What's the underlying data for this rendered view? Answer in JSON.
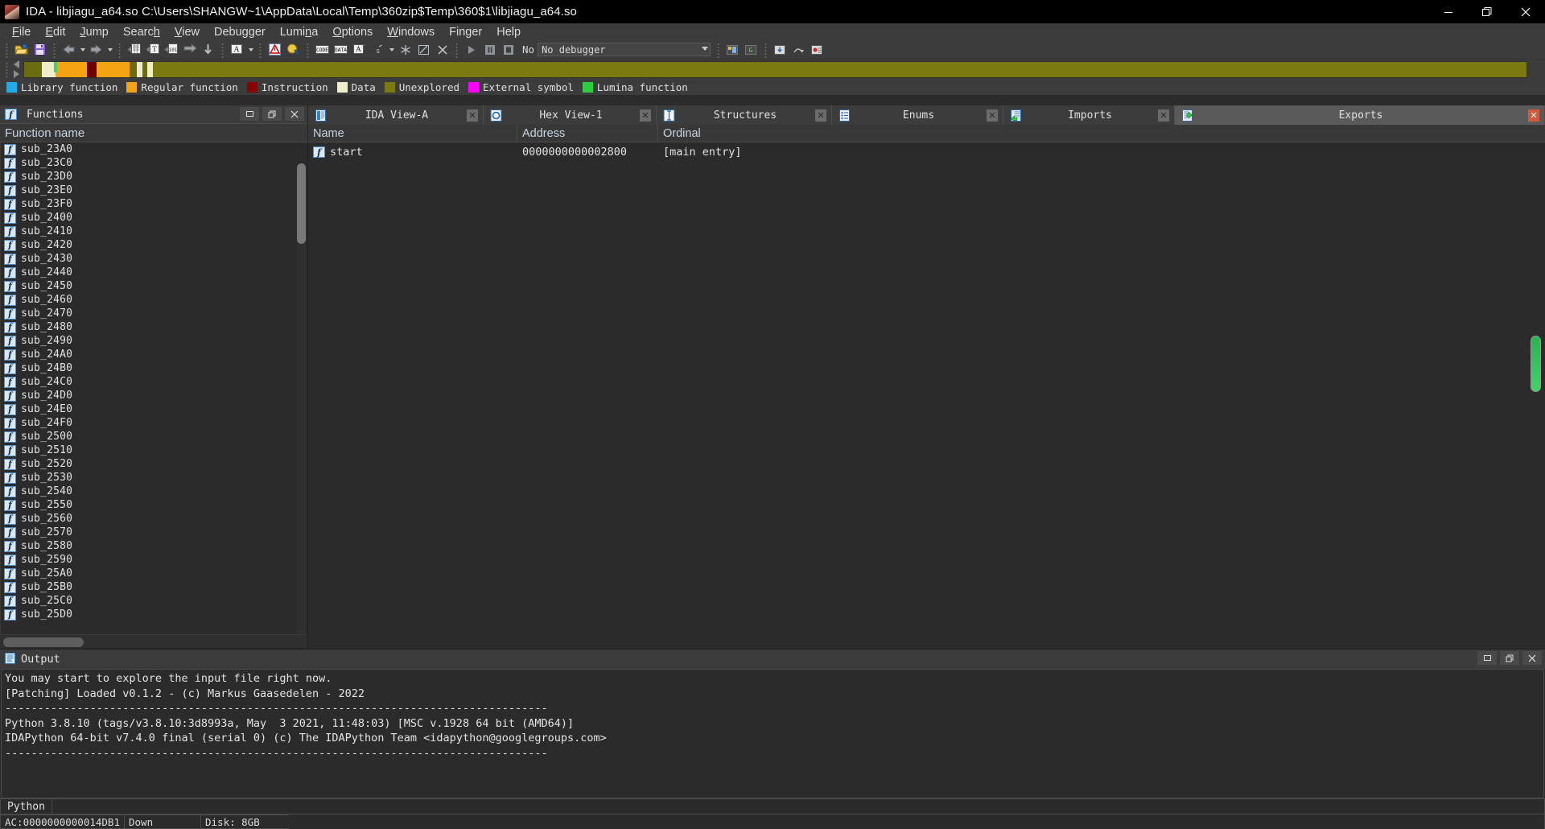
{
  "window": {
    "title": "IDA - libjiagu_a64.so C:\\Users\\SHANGW~1\\AppData\\Local\\Temp\\360zip$Temp\\360$1\\libjiagu_a64.so",
    "minimize_label": "—",
    "maximize_label": "❐",
    "close_label": "✕"
  },
  "menu": {
    "items": [
      {
        "label": "File",
        "accel": "F"
      },
      {
        "label": "Edit",
        "accel": "E"
      },
      {
        "label": "Jump",
        "accel": "J"
      },
      {
        "label": "Search",
        "accel": "h"
      },
      {
        "label": "View",
        "accel": "V"
      },
      {
        "label": "Debugger",
        "accel": "g"
      },
      {
        "label": "Lumina",
        "accel": "n"
      },
      {
        "label": "Options",
        "accel": "O"
      },
      {
        "label": "Windows",
        "accel": "W"
      },
      {
        "label": "Finger",
        "accel": ""
      },
      {
        "label": "Help",
        "accel": ""
      }
    ]
  },
  "toolbar": {
    "debugger_select_value": "No debugger",
    "debugger_label": "No",
    "icons": [
      "open-file-icon",
      "save-icon",
      "navigate-back-icon",
      "navigate-forward-icon",
      "jump-to-address-icon",
      "jump-to-text-icon",
      "jump-to-hex-icon",
      "jump-xref-icon",
      "jump-entry-icon",
      "text-search-icon",
      "alert-icon",
      "lumina-icon",
      "make-code-icon",
      "make-data-icon",
      "make-string-icon",
      "make-struct-icon",
      "make-array-icon",
      "undefine-icon",
      "run-icon",
      "pause-icon",
      "stop-icon"
    ]
  },
  "navband": {
    "segments": [
      {
        "color": "#6b6b10",
        "width": 1.2
      },
      {
        "color": "#efeecb",
        "width": 0.9
      },
      {
        "color": "#f5a313",
        "width": 2.1
      },
      {
        "color": "#6b0000",
        "width": 0.6
      },
      {
        "color": "#f5a313",
        "width": 2.2
      },
      {
        "color": "#6b6b10",
        "width": 0.5
      },
      {
        "color": "#efeecb",
        "width": 0.35
      },
      {
        "color": "#6b6b10",
        "width": 0.35
      },
      {
        "color": "#efeecb",
        "width": 0.35
      },
      {
        "color": "#7a7a10",
        "width": 91.45
      }
    ],
    "cursor_color": "#3fd46a",
    "cursor_pos_pct": 2.0
  },
  "legend": {
    "items": [
      {
        "label": "Library function",
        "color": "#25a8e6"
      },
      {
        "label": "Regular function",
        "color": "#f5a313"
      },
      {
        "label": "Instruction",
        "color": "#8b0000"
      },
      {
        "label": "Data",
        "color": "#efeecb"
      },
      {
        "label": "Unexplored",
        "color": "#7a7a10"
      },
      {
        "label": "External symbol",
        "color": "#ff00ff"
      },
      {
        "label": "Lumina function",
        "color": "#2ecc40"
      }
    ]
  },
  "functions_panel": {
    "title": "Functions",
    "icon": "function-icon",
    "column_header": "Function name",
    "buttons": [
      {
        "name": "restore-button",
        "glyph": "▭"
      },
      {
        "name": "maximize-button",
        "glyph": "❐"
      },
      {
        "name": "close-button",
        "glyph": "✕"
      }
    ],
    "rows": [
      "sub_23A0",
      "sub_23C0",
      "sub_23D0",
      "sub_23E0",
      "sub_23F0",
      "sub_2400",
      "sub_2410",
      "sub_2420",
      "sub_2430",
      "sub_2440",
      "sub_2450",
      "sub_2460",
      "sub_2470",
      "sub_2480",
      "sub_2490",
      "sub_24A0",
      "sub_24B0",
      "sub_24C0",
      "sub_24D0",
      "sub_24E0",
      "sub_24F0",
      "sub_2500",
      "sub_2510",
      "sub_2520",
      "sub_2530",
      "sub_2540",
      "sub_2550",
      "sub_2560",
      "sub_2570",
      "sub_2580",
      "sub_2590",
      "sub_25A0",
      "sub_25B0",
      "sub_25C0",
      "sub_25D0"
    ],
    "row_icon": "function-icon"
  },
  "tabs": [
    {
      "label": "IDA View-A",
      "icon": "ida-view-icon",
      "active": false,
      "closable": true,
      "close_style": "grey"
    },
    {
      "label": "Hex View-1",
      "icon": "hex-view-icon",
      "active": false,
      "closable": true,
      "close_style": "grey"
    },
    {
      "label": "Structures",
      "icon": "structures-icon",
      "active": false,
      "closable": true,
      "close_style": "grey"
    },
    {
      "label": "Enums",
      "icon": "enums-icon",
      "active": false,
      "closable": true,
      "close_style": "grey"
    },
    {
      "label": "Imports",
      "icon": "imports-icon",
      "active": false,
      "closable": true,
      "close_style": "grey"
    },
    {
      "label": "Exports",
      "icon": "exports-icon",
      "active": true,
      "closable": true,
      "close_style": "red"
    }
  ],
  "exports_table": {
    "columns": [
      "Name",
      "Address",
      "Ordinal"
    ],
    "rows": [
      {
        "name": "start",
        "address": "0000000000002800",
        "ordinal": "[main entry]",
        "icon": "function-icon"
      }
    ]
  },
  "output": {
    "title": "Output",
    "icon": "output-icon",
    "buttons": [
      {
        "name": "restore-button",
        "glyph": "▭"
      },
      {
        "name": "maximize-button",
        "glyph": "❐"
      },
      {
        "name": "close-button",
        "glyph": "✕"
      }
    ],
    "lines": [
      "You may start to explore the input file right now.",
      "[Patching] Loaded v0.1.2 - (c) Markus Gaasedelen - 2022",
      "-----------------------------------------------------------------------------------",
      "Python 3.8.10 (tags/v3.8.10:3d8993a, May  3 2021, 11:48:03) [MSC v.1928 64 bit (AMD64)]",
      "IDAPython 64-bit v7.4.0 final (serial 0) (c) The IDAPython Team <idapython@googlegroups.com>",
      "-----------------------------------------------------------------------------------"
    ]
  },
  "python_bar": {
    "label": "Python",
    "input_value": "",
    "placeholder": ""
  },
  "status_bar": {
    "address": "AC:0000000000014DB1",
    "state": "Down",
    "disk": "Disk: 8GB"
  }
}
